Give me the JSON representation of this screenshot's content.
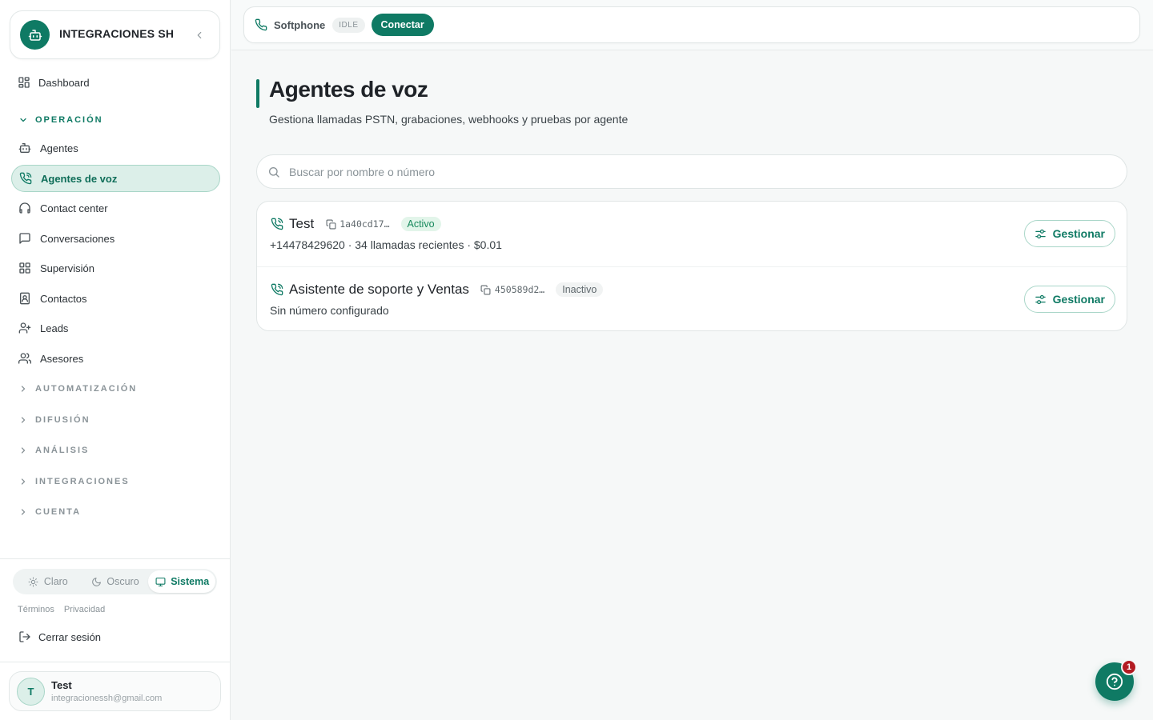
{
  "brand": {
    "name": "INTEGRACIONES SH"
  },
  "sidebar": {
    "dashboard": "Dashboard",
    "sections": {
      "operacion": "OPERACIÓN",
      "automatizacion": "AUTOMATIZACIÓN",
      "difusion": "DIFUSIÓN",
      "analisis": "ANÁLISIS",
      "integraciones": "INTEGRACIONES",
      "cuenta": "CUENTA"
    },
    "items": [
      {
        "label": "Agentes",
        "icon": "bot-icon"
      },
      {
        "label": "Agentes de voz",
        "icon": "phone-call-icon",
        "active": true
      },
      {
        "label": "Contact center",
        "icon": "headphones-icon"
      },
      {
        "label": "Conversaciones",
        "icon": "message-square-icon"
      },
      {
        "label": "Supervisión",
        "icon": "grid-icon"
      },
      {
        "label": "Contactos",
        "icon": "contact-book-icon"
      },
      {
        "label": "Leads",
        "icon": "user-plus-icon"
      },
      {
        "label": "Asesores",
        "icon": "users-icon"
      }
    ]
  },
  "theme": {
    "light": "Claro",
    "dark": "Oscuro",
    "system": "Sistema",
    "selected": "Sistema"
  },
  "legal": {
    "terms": "Términos",
    "privacy": "Privacidad"
  },
  "logout": "Cerrar sesión",
  "user": {
    "initial": "T",
    "name": "Test",
    "email": "integracionessh@gmail.com"
  },
  "topbar": {
    "softphone": "Softphone",
    "status": "IDLE",
    "connect": "Conectar"
  },
  "page": {
    "title": "Agentes de voz",
    "subtitle": "Gestiona llamadas PSTN, grabaciones, webhooks y pruebas por agente"
  },
  "search": {
    "placeholder": "Buscar por nombre o número",
    "value": ""
  },
  "agents": [
    {
      "name": "Test",
      "id": "1a40cd17…",
      "status": "Activo",
      "meta": "+14478429620 · 34 llamadas recientes · $0.01",
      "action": "Gestionar"
    },
    {
      "name": "Asistente de soporte y Ventas",
      "id": "450589d2…",
      "status": "Inactivo",
      "meta": "Sin número configurado",
      "action": "Gestionar"
    }
  ],
  "help": {
    "badge": "1"
  },
  "colors": {
    "accent": "#0f7a64",
    "active_bg": "#dcefe9",
    "badge_red": "#b21b22"
  }
}
